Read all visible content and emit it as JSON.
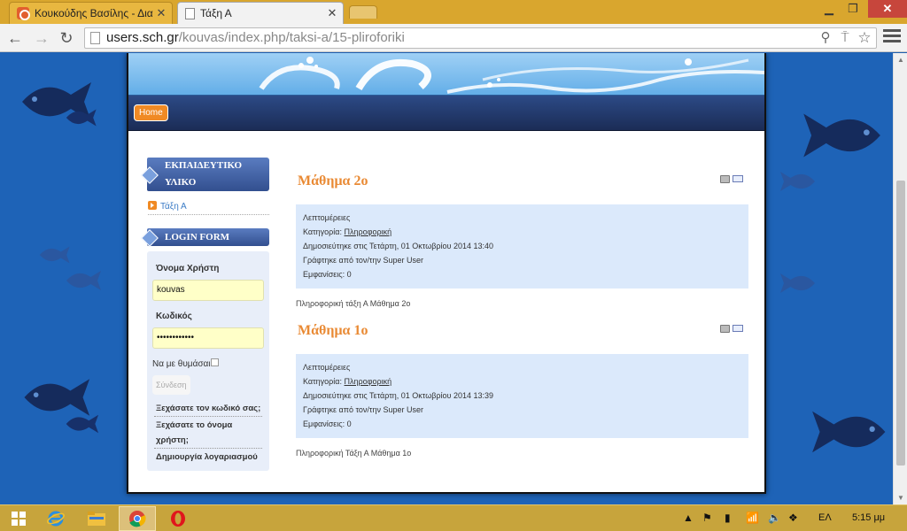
{
  "browser": {
    "tabs": [
      {
        "title": "Κουκούδης Βασίλης - Δια",
        "active": false
      },
      {
        "title": "Τάξη Α",
        "active": true
      }
    ],
    "url": {
      "host": "users.sch.gr",
      "path": "/kouvas/index.php/taksi-a/15-pliroforiki"
    }
  },
  "site": {
    "nav": {
      "home_label": "Home"
    },
    "sidebar": {
      "edu_module_title_line1": "ΕΚΠΑΙΔΕΥΤΙΚΟ",
      "edu_module_title_line2": "ΥΛΙΚΟ",
      "edu_link": "Τάξη Α",
      "login_module_title": "LOGIN FORM",
      "login": {
        "username_label": "Όνομα Χρήστη",
        "username_value": "kouvas",
        "password_label": "Κωδικός",
        "password_value": "••••••••••••",
        "remember_label": "Να με θυμάσαι",
        "submit_label": "Σύνδεση",
        "forgot_password": "Ξεχάσατε τον κωδικό σας;",
        "forgot_username_line1": "Ξεχάσατε το όνομα",
        "forgot_username_line2": "χρήστη;",
        "create_account": "Δημιουργία λογαριασμού"
      }
    },
    "articles": [
      {
        "title": "Μάθημα 2ο",
        "details_heading": "Λεπτομέρειες",
        "category_label": "Κατηγορία:",
        "category": "Πληροφορική",
        "published": "Δημοσιεύτηκε στις Τετάρτη, 01 Οκτωβρίου 2014 13:40",
        "author": "Γράφτηκε από τον/την Super User",
        "hits": "Εμφανίσεις: 0",
        "intro": "Πληροφορική τάξη Α Μάθημα 2ο"
      },
      {
        "title": "Μάθημα 1ο",
        "details_heading": "Λεπτομέρειες",
        "category_label": "Κατηγορία:",
        "category": "Πληροφορική",
        "published": "Δημοσιεύτηκε στις Τετάρτη, 01 Οκτωβρίου 2014 13:39",
        "author": "Γράφτηκε από τον/την Super User",
        "hits": "Εμφανίσεις: 0",
        "intro": "Πληροφορική Τάξη Α Μάθημα 1ο"
      }
    ]
  },
  "taskbar": {
    "language": "ΕΛ",
    "clock": "5:15 μμ"
  },
  "colors": {
    "accent_title": "#e98a34",
    "nav_dark": "#1b2c56",
    "details_bg": "#dbe9fb",
    "taskbar": "#c7a43c"
  }
}
